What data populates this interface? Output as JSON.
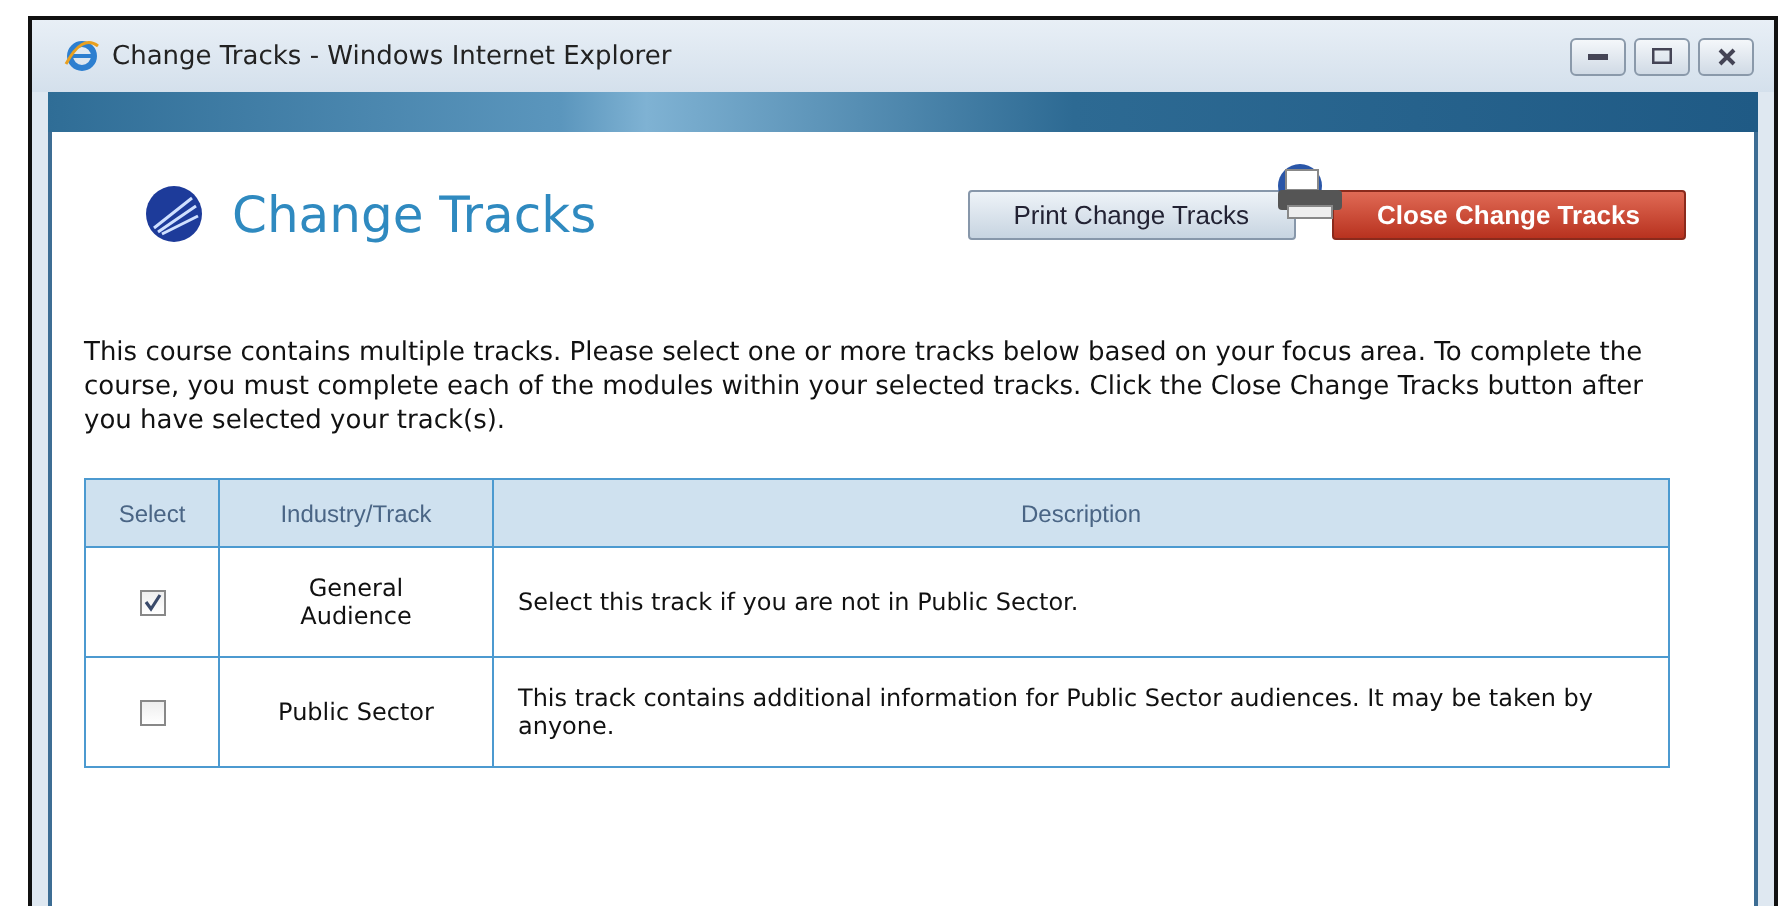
{
  "window": {
    "title": "Change Tracks - Windows Internet Explorer"
  },
  "page": {
    "heading": "Change Tracks",
    "buttons": [
      {
        "label": "Print Change Tracks",
        "kind": "print"
      },
      {
        "label": "Close Change Tracks",
        "kind": "close"
      }
    ],
    "intro": "This course contains multiple tracks. Please select one or more tracks below based on your focus area. To complete the course, you must complete each of the modules within your selected tracks. Click the Close Change Tracks button after you have selected your track(s)."
  },
  "table": {
    "columns": [
      "Select",
      "Industry/Track",
      "Description"
    ],
    "rows": [
      {
        "checked": true,
        "track": "General Audience",
        "description": "Select this track if you are not in Public Sector."
      },
      {
        "checked": false,
        "track": "Public Sector",
        "description": "This track contains additional information for Public Sector audiences. It may be taken by anyone."
      }
    ]
  }
}
